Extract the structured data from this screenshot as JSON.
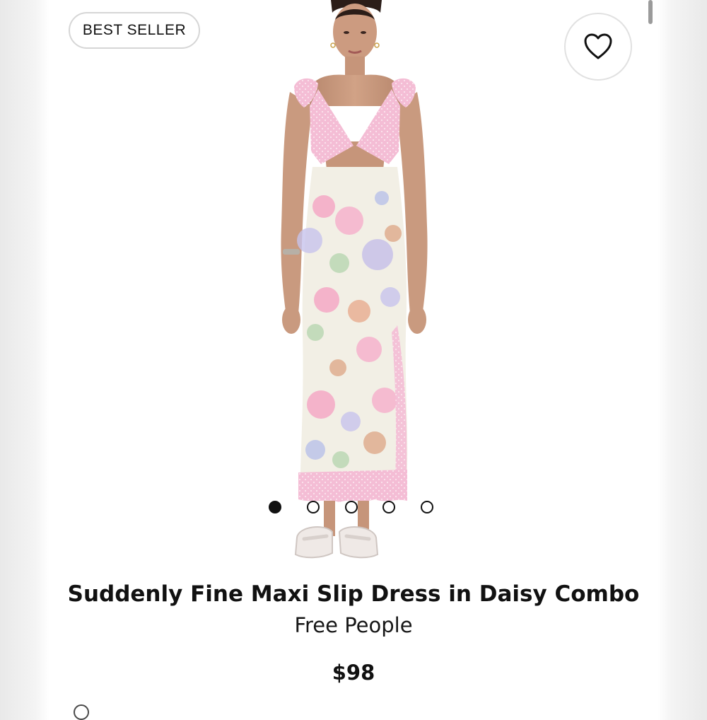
{
  "badge": {
    "label": "BEST SELLER"
  },
  "favorite": {
    "icon": "heart-outline-icon"
  },
  "gallery": {
    "image_alt": "Suddenly Fine Maxi Slip Dress in Daisy Combo",
    "slide_count": 5,
    "active_slide": 1
  },
  "product": {
    "title": "Suddenly Fine Maxi Slip Dress in Daisy Combo",
    "brand": "Free People",
    "price": "$98"
  },
  "colors": {
    "text": "#111111",
    "badge_border": "#d6d6d6",
    "lace_pink": "#f3b8d3",
    "dress_cream": "#f2efe5"
  }
}
